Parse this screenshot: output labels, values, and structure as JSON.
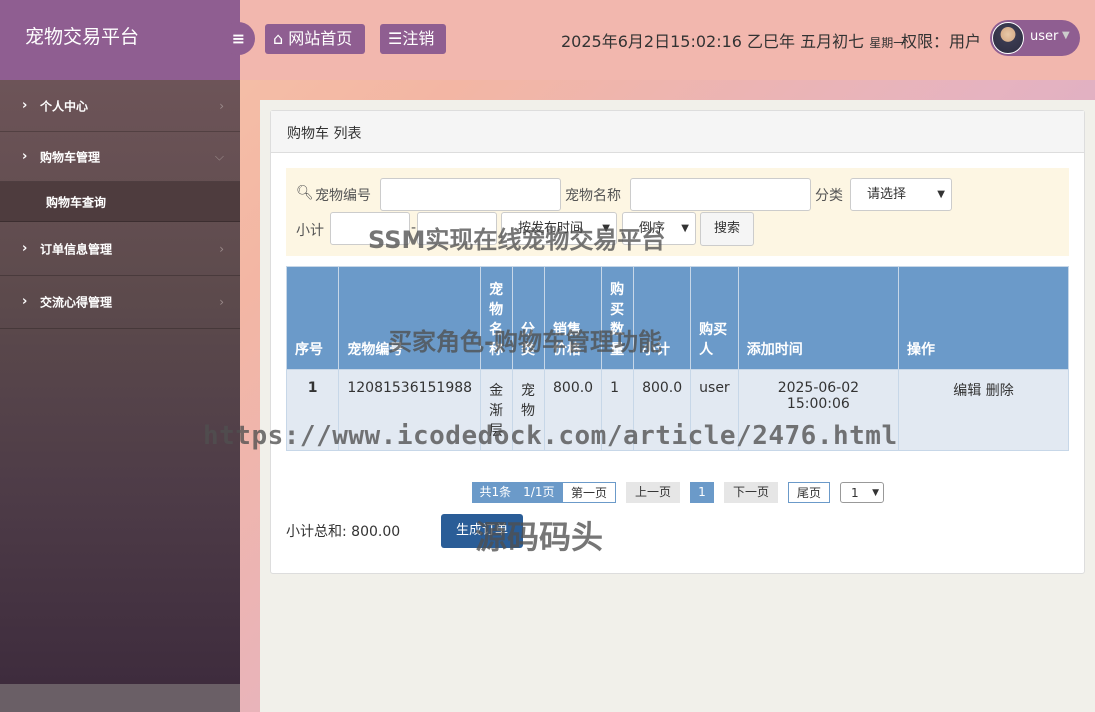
{
  "brand": "宠物交易平台",
  "sidebar": {
    "items": [
      {
        "label": "个人中心"
      },
      {
        "label": "购物车管理"
      },
      {
        "label": "购物车查询"
      },
      {
        "label": "订单信息管理"
      },
      {
        "label": "交流心得管理"
      }
    ]
  },
  "header": {
    "home_label": "网站首页",
    "logout_label": "注销",
    "datetime": "2025年6月2日15:02:16 乙巳年 五月初七",
    "weekday": "星期一",
    "permission": "权限：用户",
    "username": "user"
  },
  "panel": {
    "title": "购物车 列表"
  },
  "filter": {
    "pet_no_label": "宠物编号",
    "pet_name_label": "宠物名称",
    "category_label": "分类",
    "category_value": "请选择",
    "subtotal_label": "小计",
    "dash": "-",
    "sort_value": "按发布时间",
    "order_value": "倒序",
    "search_label": "搜索"
  },
  "table": {
    "headers": [
      "序号",
      "宠物编号",
      "宠物名称",
      "分类",
      "销售价格",
      "购买数量",
      "小计",
      "购买人",
      "添加时间",
      "操作"
    ],
    "rows": [
      {
        "index": "1",
        "pet_no": "12081536151988",
        "pet_name": "金渐层",
        "category": "宠物",
        "price": "800.0",
        "qty": "1",
        "subtotal": "800.0",
        "buyer": "user",
        "added": "2025-06-02 15:00:06",
        "edit": "编辑",
        "delete": "删除"
      }
    ]
  },
  "pager": {
    "total": "共1条　1/1页",
    "first": "第一页",
    "prev": "上一页",
    "current": "1",
    "next": "下一页",
    "last": "尾页",
    "select": "1"
  },
  "footer": {
    "subtotal_sum": "小计总和: 800.00",
    "order_btn": "生成订单"
  },
  "watermarks": {
    "w1": "SSM实现在线宠物交易平台",
    "w2": "买家角色-购物车管理功能",
    "w3": "https://www.icodedock.com/article/2476.html",
    "w4": "源码码头"
  },
  "colors": {
    "brand_purple": "#8f5e91",
    "header_bg": "#f2b7ae",
    "table_head": "#6b9ac9",
    "table_row": "#e2e9f2",
    "primary_button": "#2a5d97"
  }
}
